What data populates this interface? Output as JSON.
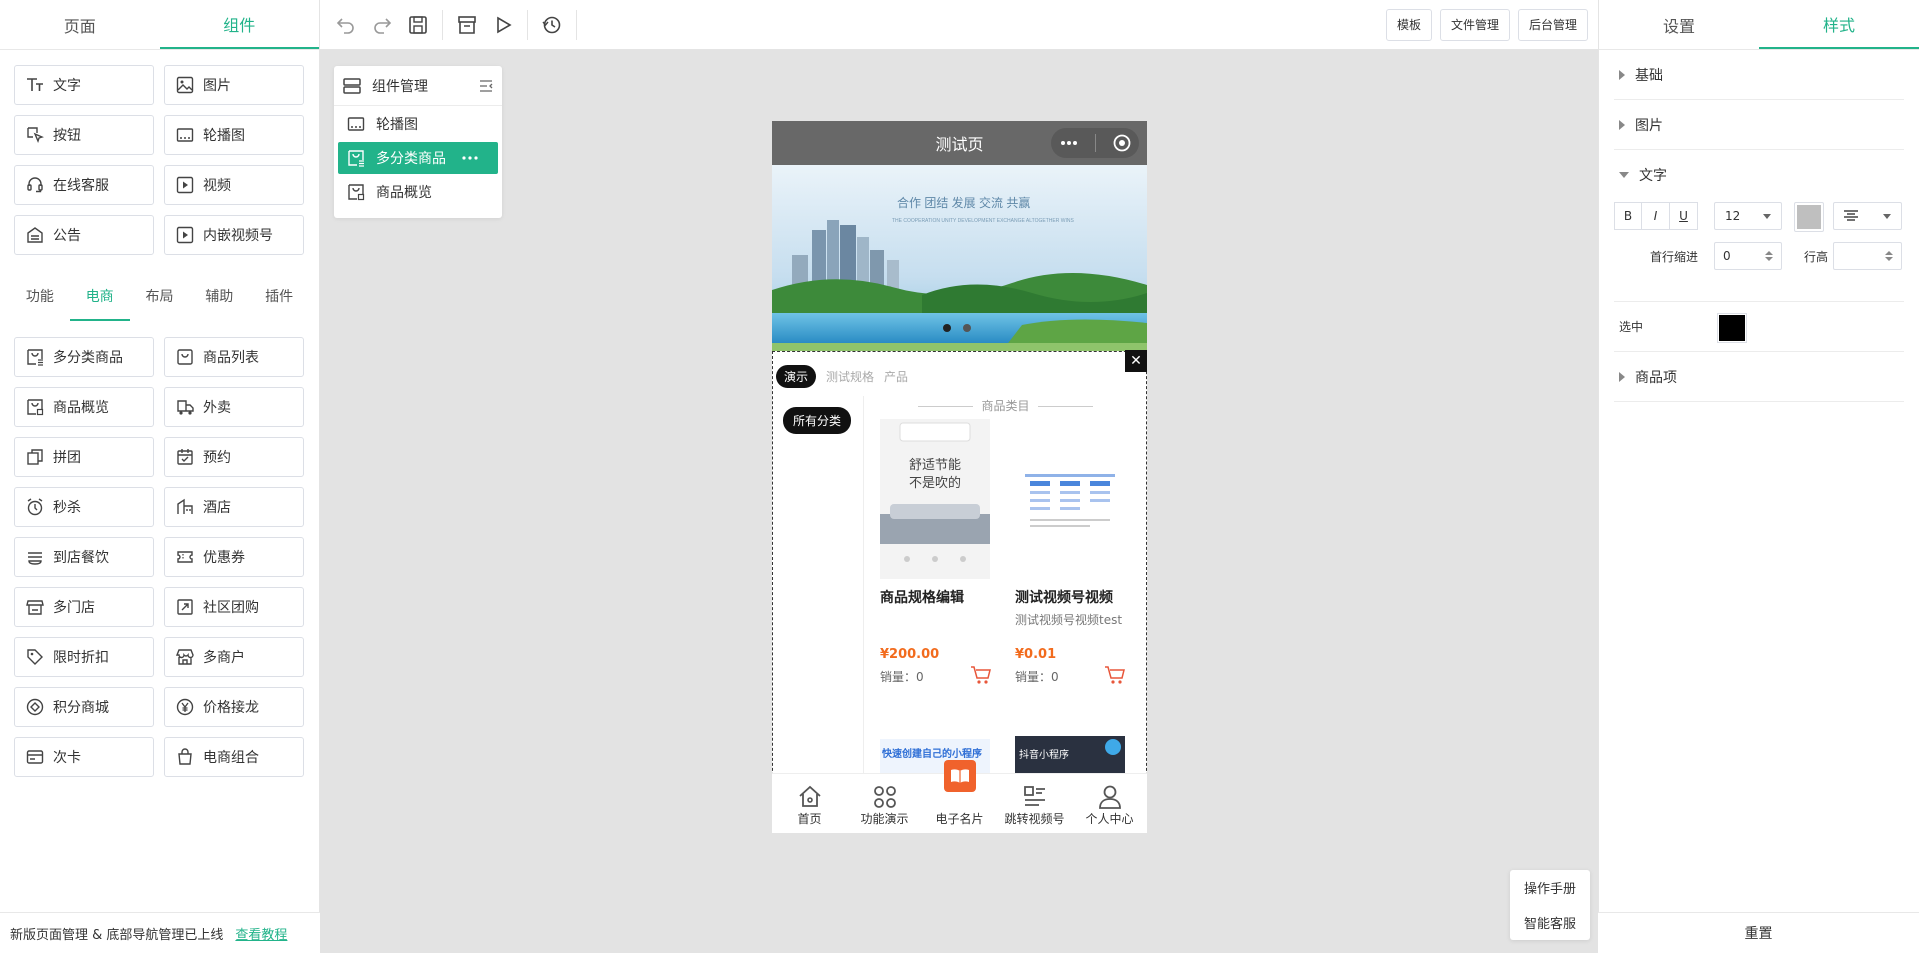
{
  "left": {
    "tabs": [
      "页面",
      "组件"
    ],
    "basic_components": [
      {
        "label": "文字",
        "icon": "text-icon"
      },
      {
        "label": "图片",
        "icon": "image-icon"
      },
      {
        "label": "按钮",
        "icon": "button-icon"
      },
      {
        "label": "轮播图",
        "icon": "carousel-icon"
      },
      {
        "label": "在线客服",
        "icon": "headset-icon"
      },
      {
        "label": "视频",
        "icon": "video-icon"
      },
      {
        "label": "公告",
        "icon": "notice-icon"
      },
      {
        "label": "内嵌视频号",
        "icon": "embedded-video-icon"
      }
    ],
    "subtabs": [
      "功能",
      "电商",
      "布局",
      "辅助",
      "插件"
    ],
    "ecommerce_components": [
      {
        "label": "多分类商品",
        "icon": "multi-category-icon"
      },
      {
        "label": "商品列表",
        "icon": "product-list-icon"
      },
      {
        "label": "商品概览",
        "icon": "product-overview-icon"
      },
      {
        "label": "外卖",
        "icon": "delivery-icon"
      },
      {
        "label": "拼团",
        "icon": "group-buy-icon"
      },
      {
        "label": "预约",
        "icon": "calendar-icon"
      },
      {
        "label": "秒杀",
        "icon": "alarm-icon"
      },
      {
        "label": "酒店",
        "icon": "hotel-icon"
      },
      {
        "label": "到店餐饮",
        "icon": "dining-icon"
      },
      {
        "label": "优惠券",
        "icon": "coupon-icon"
      },
      {
        "label": "多门店",
        "icon": "store-icon"
      },
      {
        "label": "社区团购",
        "icon": "community-icon"
      },
      {
        "label": "限时折扣",
        "icon": "tag-icon"
      },
      {
        "label": "多商户",
        "icon": "merchant-icon"
      },
      {
        "label": "积分商城",
        "icon": "points-icon"
      },
      {
        "label": "价格接龙",
        "icon": "yen-icon"
      },
      {
        "label": "次卡",
        "icon": "card-icon"
      },
      {
        "label": "电商组合",
        "icon": "bag-icon"
      }
    ],
    "footer_text": "新版页面管理 & 底部导航管理已上线",
    "footer_link": "查看教程"
  },
  "toolbar": {
    "buttons": [
      "模板",
      "文件管理",
      "后台管理"
    ]
  },
  "component_manager": {
    "title": "组件管理",
    "items": [
      "轮播图",
      "多分类商品",
      "商品概览"
    ]
  },
  "phone": {
    "title": "测试页",
    "banner_slogan": "合作 团结 发展 交流 共赢",
    "banner_sub": "THE COOPERATION UNITY DEVELOPMENT EXCHANGE ALTOGETHER WINS",
    "tabs": [
      "演示",
      "测试规格",
      "产品"
    ],
    "category_pill": "所有分类",
    "category_title": "商品类目",
    "products": [
      {
        "name": "商品规格编辑",
        "desc": "",
        "price": "¥200.00",
        "sales": "销量：0",
        "img_text": "舒适节能 不是吹的"
      },
      {
        "name": "测试视频号视频",
        "desc": "测试视频号视频test",
        "price": "¥0.01",
        "sales": "销量：0",
        "img_text": ""
      }
    ],
    "more_tiles": [
      "快速创建自己的小程序",
      "抖音小程序"
    ],
    "nav": [
      "首页",
      "功能演示",
      "电子名片",
      "跳转视频号",
      "个人中心"
    ]
  },
  "right": {
    "tabs": [
      "设置",
      "样式"
    ],
    "sections": [
      "基础",
      "图片",
      "文字",
      "商品项"
    ],
    "font_size": "12",
    "indent_label": "首行缩进",
    "indent_value": "0",
    "line_height_label": "行高",
    "selected_label": "选中",
    "text_color": "#bfbfbf",
    "selected_color": "#000000",
    "reset": "重置"
  },
  "help": [
    "操作手册",
    "智能客服"
  ],
  "accent": "#22b38a"
}
